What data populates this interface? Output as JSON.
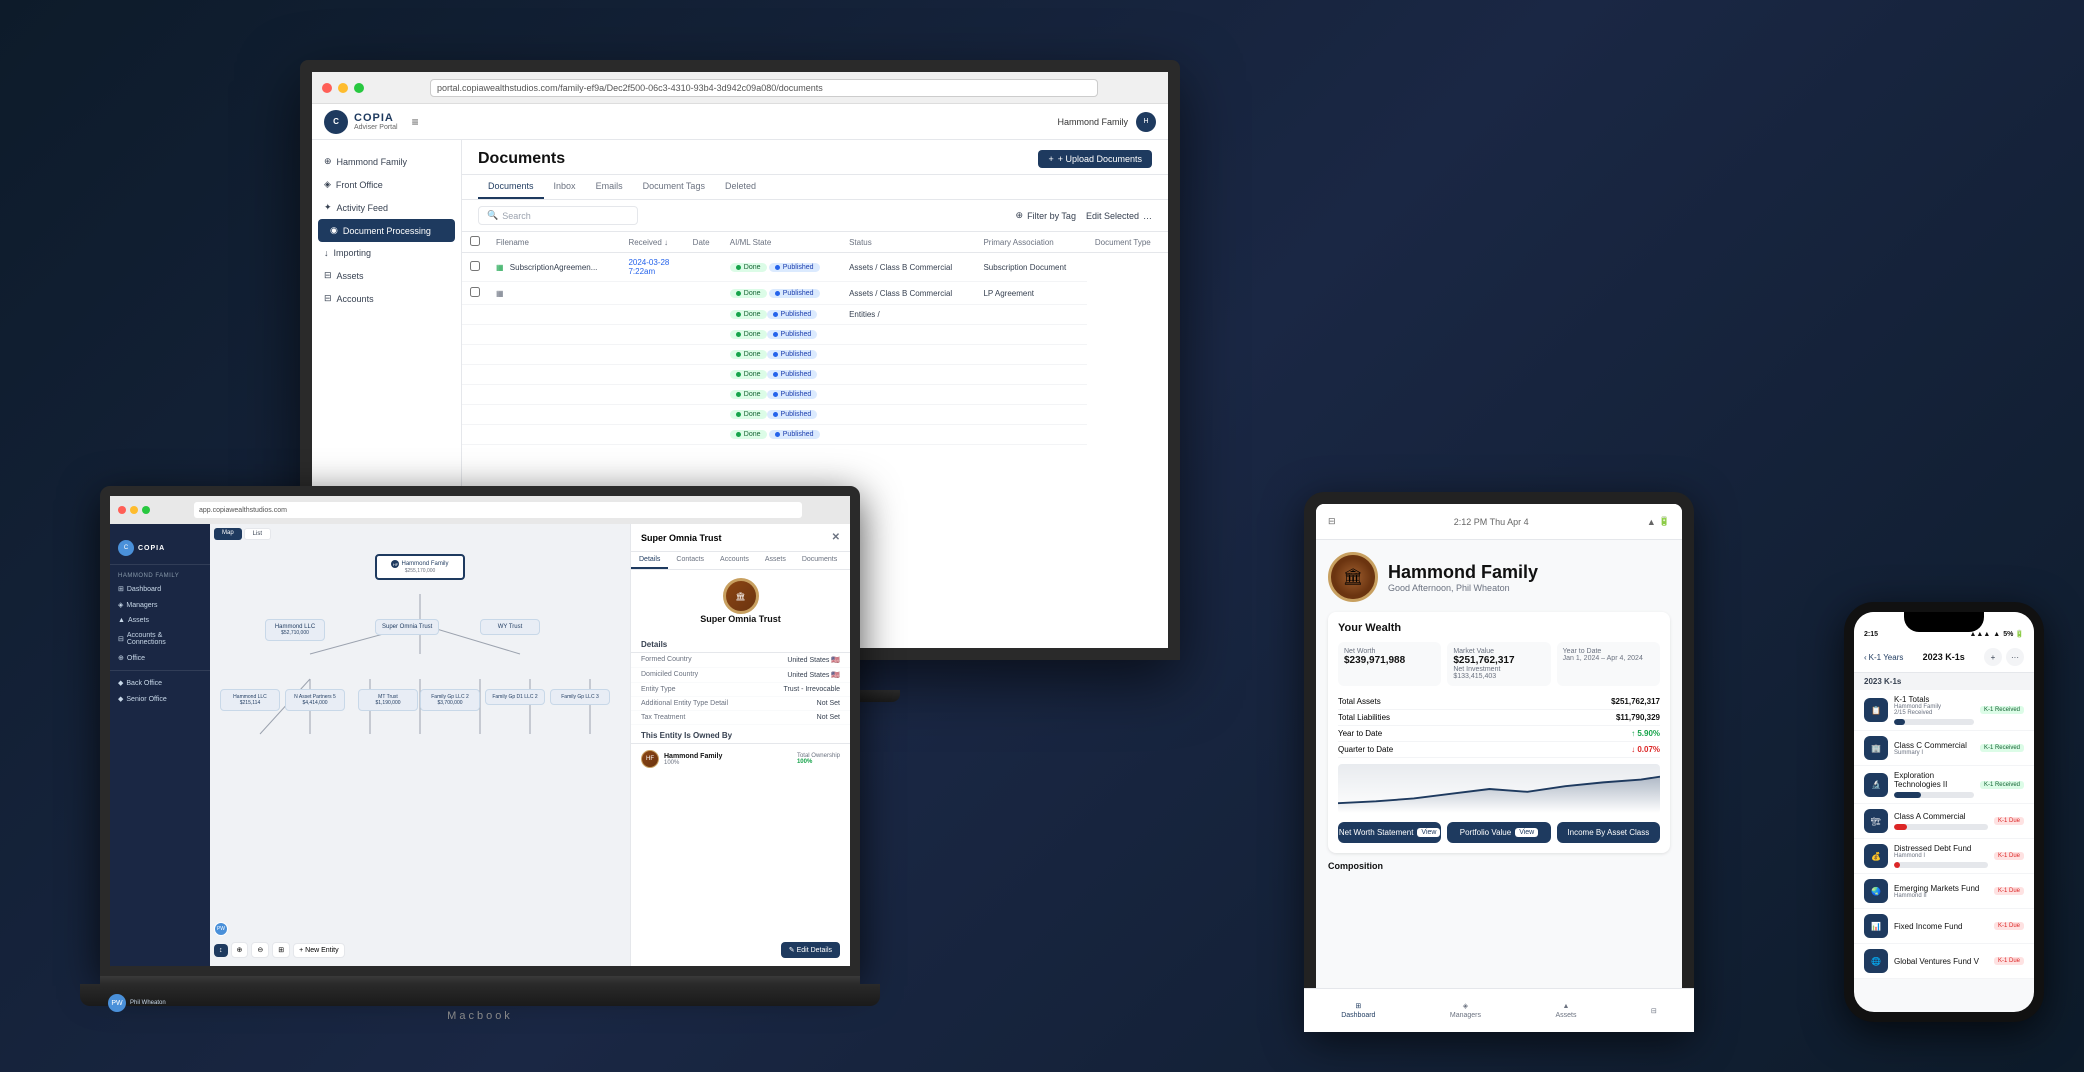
{
  "scene": {
    "background": "#1a1a2e"
  },
  "monitor": {
    "url": "portal.copiawealthstudios.com/family-ef9a/Dec2f500-06c3-4310-93b4-3d942c09a080/documents",
    "topbar": {
      "logo": "COPIA",
      "logo_sub": "Adviser Portal",
      "user": "Hammond Family",
      "menu_icon": "≡"
    },
    "sidebar": {
      "items": [
        {
          "label": "Hammond Family",
          "icon": "⊕",
          "active": false
        },
        {
          "label": "Front Office",
          "icon": "◈",
          "active": false
        },
        {
          "label": "Activity Feed",
          "icon": "✦",
          "active": false
        },
        {
          "label": "Document Processing",
          "icon": "◉",
          "active": true
        },
        {
          "label": "Importing",
          "icon": "↓",
          "active": false
        },
        {
          "label": "Assets",
          "icon": "⊟",
          "active": false
        },
        {
          "label": "Accounts",
          "icon": "⊟",
          "active": false
        }
      ]
    },
    "page": {
      "title": "Documents",
      "upload_button": "+ Upload Documents",
      "tabs": [
        "Documents",
        "Inbox",
        "Emails",
        "Document Tags",
        "Deleted"
      ],
      "active_tab": "Documents",
      "search_placeholder": "Search",
      "filter_label": "Filter by Tag",
      "edit_selected": "Edit Selected",
      "table": {
        "headers": [
          "Filename",
          "Received ↓",
          "Date",
          "AI/ML State",
          "Status",
          "Primary Association",
          "Document Type"
        ],
        "rows": [
          {
            "filename": "SubscriptionAgreemen...",
            "received": "2024-03-28",
            "date": "7:22am",
            "aiml": "Done",
            "status": "Published",
            "association": "Assets / Class B Commercial",
            "doc_type": "Subscription Document"
          },
          {
            "filename": "",
            "received": "",
            "date": "",
            "aiml": "Done",
            "status": "Published",
            "association": "Assets / Class B Commercial",
            "doc_type": "LP Agreement"
          },
          {
            "filename": "",
            "received": "",
            "date": "",
            "aiml": "Done",
            "status": "Published",
            "association": "Entities /",
            "doc_type": ""
          },
          {
            "filename": "",
            "received": "",
            "date": "",
            "aiml": "Done",
            "status": "Published",
            "association": "",
            "doc_type": ""
          },
          {
            "filename": "",
            "received": "",
            "date": "",
            "aiml": "Done",
            "status": "Published",
            "association": "",
            "doc_type": ""
          },
          {
            "filename": "",
            "received": "",
            "date": "",
            "aiml": "Done",
            "status": "Published",
            "association": "",
            "doc_type": ""
          },
          {
            "filename": "",
            "received": "",
            "date": "",
            "aiml": "Done",
            "status": "Published",
            "association": "",
            "doc_type": ""
          },
          {
            "filename": "",
            "received": "",
            "date": "",
            "aiml": "Done",
            "status": "Published",
            "association": "",
            "doc_type": ""
          },
          {
            "filename": "",
            "received": "",
            "date": "",
            "aiml": "Done",
            "status": "Done Published",
            "association": "",
            "doc_type": ""
          }
        ]
      }
    }
  },
  "laptop": {
    "url": "app.copiawealthstudios.com",
    "sidebar": {
      "client": "HAMMOND FAMILY",
      "items": [
        "Dashboard",
        "Managers",
        "Assets",
        "Accounts & Connections",
        "Office",
        "Back Office",
        "Senior Office"
      ]
    },
    "modal": {
      "title": "Super Omnia Trust",
      "tabs": [
        "Details",
        "Contacts",
        "Accounts",
        "Assets",
        "Documents"
      ],
      "active_tab": "Details",
      "fields": [
        {
          "label": "Formed Country",
          "value": "United States 🇺🇸"
        },
        {
          "label": "Domiciled Country",
          "value": "United States 🇺🇸"
        },
        {
          "label": "Entity Type",
          "value": "Trust - Irrevocable"
        },
        {
          "label": "Additional Entity Type Detail",
          "value": "Not Set"
        },
        {
          "label": "Tax Treatment",
          "value": "Not Set"
        }
      ],
      "owned_by_section": "This Entity Is Owned By",
      "owner": "Hammond Family",
      "ownership_pct": "100%",
      "total_ownership": "Total Ownership",
      "edit_button": "Edit Details"
    }
  },
  "tablet": {
    "time": "2:12 PM  Thu Apr 4",
    "family_name": "Hammond Family",
    "greeting": "Good Afternoon, Phil Wheaton",
    "wealth": {
      "section_title": "Your Wealth",
      "net_worth_label": "Net Worth",
      "net_worth_value": "$239,971,988",
      "market_value_label": "Market Value",
      "market_value_value": "$251,762,317",
      "net_investment_label": "Net Investment",
      "net_investment_value": "$133,415,403",
      "ytd_label": "Year to Date",
      "ytd_range": "Jan 1, 2024 – Apr 4, 2024",
      "total_assets_label": "Total Assets",
      "total_assets_value": "$251,762,317",
      "total_liabilities_label": "Total Liabilities",
      "total_liabilities_value": "$11,790,329",
      "ytd_val": "↑ 5.90%",
      "qtd_label": "Quarter to Date",
      "qtd_val": "↓ 0.07%",
      "buttons": {
        "net_worth_statement": "Net Worth Statement",
        "view1": "View",
        "portfolio_value": "Portfolio Value",
        "view2": "View",
        "income_asset_class": "Income By Asset Class"
      }
    },
    "bottom_tabs": [
      "Dashboard",
      "Managers",
      "Assets"
    ]
  },
  "phone": {
    "time": "2:15",
    "battery": "5% 🔋",
    "header_back": "K-1 Years",
    "title": "2023 K-1s",
    "action_plus": "+",
    "action_dots": "···",
    "section": "2023 K-1s",
    "items": [
      {
        "name": "K-1 Totals",
        "sub": "Hammond Family",
        "sub2": "2/15 Received",
        "badge": "K-1 Received",
        "badge_type": "received",
        "progress": 14
      },
      {
        "name": "Class C Commercial",
        "sub": "Summary I",
        "sub2": "",
        "badge": "K-1 Received",
        "badge_type": "received",
        "progress": 0
      },
      {
        "name": "Exploration Technologies II",
        "sub": "",
        "sub2": "",
        "badge": "K-1 Received",
        "badge_type": "received",
        "progress": 34
      },
      {
        "name": "Class A Commercial",
        "sub": "",
        "sub2": "",
        "badge": "K-1 Due",
        "badge_type": "due",
        "progress": 14
      },
      {
        "name": "Distressed Debt Fund",
        "sub": "Hammond I",
        "sub2": "",
        "badge": "K-1 Due",
        "badge_type": "due",
        "progress": 6
      },
      {
        "name": "Emerging Markets Fund",
        "sub": "Hammond II",
        "sub2": "",
        "badge": "K-1 Due",
        "badge_type": "due",
        "progress": 0
      },
      {
        "name": "Fixed Income Fund",
        "sub": "",
        "sub2": "",
        "badge": "K-1 Due",
        "badge_type": "due",
        "progress": 0
      },
      {
        "name": "Global Ventures Fund V",
        "sub": "",
        "sub2": "",
        "badge": "K-1 Due",
        "badge_type": "due",
        "progress": 0
      }
    ]
  }
}
